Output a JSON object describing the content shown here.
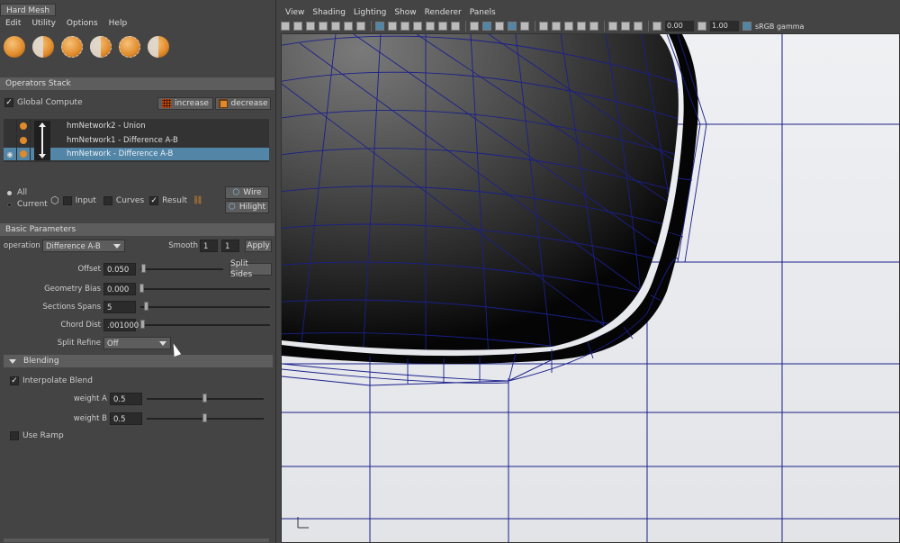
{
  "window": {
    "title": "Hard Mesh"
  },
  "menu": [
    "Edit",
    "Utility",
    "Options",
    "Help"
  ],
  "shelf": [
    {
      "icon": "orange-sphere-icon"
    },
    {
      "icon": "orange-half-sphere-icon"
    },
    {
      "icon": "orange-sphere-dashed-icon"
    },
    {
      "icon": "orange-half-sphere-dashed-icon"
    },
    {
      "icon": "orange-sphere-outline-icon"
    },
    {
      "icon": "orange-sphere-cut-icon"
    }
  ],
  "operators_stack": {
    "header": "Operators Stack",
    "global_compute": "Global Compute",
    "increase": "increase",
    "decrease": "decrease",
    "items": [
      {
        "label": "hmNetwork2 - Union",
        "selected": false
      },
      {
        "label": "hmNetwork1 - Difference A-B",
        "selected": false
      },
      {
        "label": "hmNetwork - Difference A-B",
        "selected": true
      }
    ],
    "all": "All",
    "current": "Current",
    "input": "Input",
    "curves": "Curves",
    "result": "Result",
    "wire": "Wire",
    "hilight": "Hilight"
  },
  "basic": {
    "header": "Basic Parameters",
    "operation_label": "operation",
    "operation_value": "Difference A-B",
    "smooth_label": "Smooth",
    "smooth_a": "1",
    "smooth_b": "1",
    "apply": "Apply",
    "offset_label": "Offset",
    "offset_value": "0.050",
    "split_sides": "Split Sides",
    "geometry_bias_label": "Geometry Bias",
    "geometry_bias_value": "0.000",
    "sections_spans_label": "Sections Spans",
    "sections_spans_value": "5",
    "chord_dist_label": "Chord Dist",
    "chord_dist_value": ".001000",
    "split_refine_label": "Split Refine",
    "split_refine_value": "Off"
  },
  "blending": {
    "header": "Blending",
    "interpolate_blend": "Interpolate Blend",
    "weight_a_label": "weight A",
    "weight_a_value": "0.5",
    "weight_b_label": "weight B",
    "weight_b_value": "0.5",
    "use_ramp": "Use Ramp"
  },
  "viewport": {
    "menu": [
      "View",
      "Shading",
      "Lighting",
      "Show",
      "Renderer",
      "Panels"
    ],
    "exposure": "0.00",
    "gamma": "1.00",
    "color_space": "sRGB gamma"
  }
}
